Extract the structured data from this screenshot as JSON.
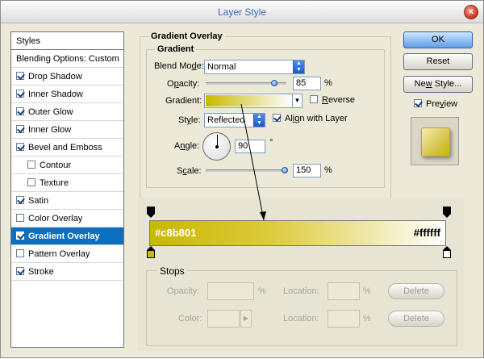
{
  "window": {
    "title": "Layer Style",
    "close_glyph": "×"
  },
  "styles_panel": {
    "items": [
      {
        "label": "Styles",
        "checkbox": false,
        "checked": false,
        "indent": false,
        "selected": false
      },
      {
        "label": "Blending Options: Custom",
        "checkbox": false,
        "checked": false,
        "indent": false,
        "selected": false
      },
      {
        "label": "Drop Shadow",
        "checkbox": true,
        "checked": true,
        "indent": false,
        "selected": false
      },
      {
        "label": "Inner Shadow",
        "checkbox": true,
        "checked": true,
        "indent": false,
        "selected": false
      },
      {
        "label": "Outer Glow",
        "checkbox": true,
        "checked": true,
        "indent": false,
        "selected": false
      },
      {
        "label": "Inner Glow",
        "checkbox": true,
        "checked": true,
        "indent": false,
        "selected": false
      },
      {
        "label": "Bevel and Emboss",
        "checkbox": true,
        "checked": true,
        "indent": false,
        "selected": false
      },
      {
        "label": "Contour",
        "checkbox": true,
        "checked": false,
        "indent": true,
        "selected": false
      },
      {
        "label": "Texture",
        "checkbox": true,
        "checked": false,
        "indent": true,
        "selected": false
      },
      {
        "label": "Satin",
        "checkbox": true,
        "checked": true,
        "indent": false,
        "selected": false
      },
      {
        "label": "Color Overlay",
        "checkbox": true,
        "checked": false,
        "indent": false,
        "selected": false
      },
      {
        "label": "Gradient Overlay",
        "checkbox": true,
        "checked": true,
        "indent": false,
        "selected": true
      },
      {
        "label": "Pattern Overlay",
        "checkbox": true,
        "checked": false,
        "indent": false,
        "selected": false
      },
      {
        "label": "Stroke",
        "checkbox": true,
        "checked": true,
        "indent": false,
        "selected": false
      }
    ]
  },
  "gradient_overlay": {
    "section_title": "Gradient Overlay",
    "group_title": "Gradient",
    "blend_mode": {
      "label_pre": "Blend Mo",
      "label_u": "d",
      "label_post": "e:",
      "value": "Normal"
    },
    "opacity": {
      "label_pre": "O",
      "label_u": "p",
      "label_post": "acity:",
      "value": "85",
      "unit": "%",
      "level": 0.85
    },
    "gradient": {
      "label": "Gradient:"
    },
    "reverse": {
      "label_u": "R",
      "label_post": "everse",
      "checked": false
    },
    "style": {
      "label_pre": "St",
      "label_u": "y",
      "label_post": "le:",
      "value": "Reflected"
    },
    "align_with_layer": {
      "label_pre": "Al",
      "label_u": "i",
      "label_post": "gn with Layer",
      "checked": true
    },
    "angle": {
      "label_pre": "A",
      "label_u": "n",
      "label_post": "gle:",
      "value": "90",
      "unit": "°"
    },
    "scale": {
      "label_pre": "S",
      "label_u": "c",
      "label_post": "ale:",
      "value": "150",
      "unit": "%",
      "level": 1.0
    }
  },
  "gradient_editor": {
    "left_hex": "#c8b801",
    "right_hex": "#ffffff",
    "left_color": "#c8b801",
    "right_color": "#ffffff",
    "stops_title": "Stops",
    "opacity_label": "Opacity:",
    "opacity_unit": "%",
    "location_label": "Location:",
    "location_unit": "%",
    "color_label": "Color:",
    "delete_label": "Delete"
  },
  "buttons": {
    "ok": "OK",
    "reset": "Reset",
    "new_style_pre": "Ne",
    "new_style_u": "w",
    "new_style_post": " Style...",
    "preview_pre": "Pre",
    "preview_u": "v",
    "preview_post": "iew",
    "preview_checked": true
  },
  "colors": {
    "accent": "#0c6fc0",
    "gradient_start": "#c8b801",
    "gradient_end": "#ffffff"
  }
}
